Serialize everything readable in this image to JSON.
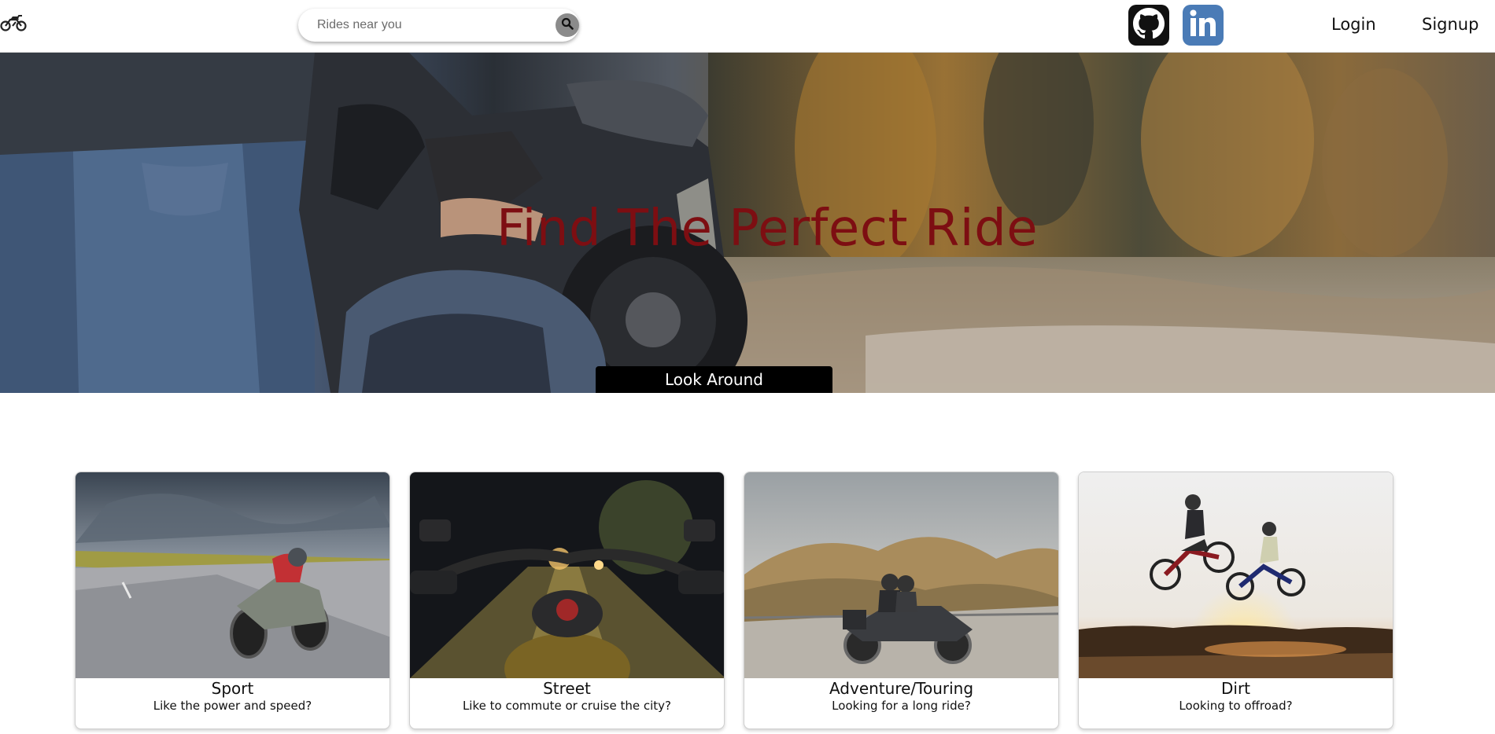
{
  "header": {
    "logo_icon": "motorcycle-icon",
    "search": {
      "placeholder": "Rides near you",
      "value": "",
      "button_icon": "search-icon"
    },
    "social": [
      {
        "name": "github",
        "icon": "github-icon",
        "color": "#111111"
      },
      {
        "name": "linkedin",
        "icon": "linkedin-icon",
        "color": "#4a7bb6"
      }
    ],
    "nav": {
      "login_label": "Login",
      "signup_label": "Signup"
    }
  },
  "hero": {
    "title": "Find The Perfect Ride",
    "title_color": "#7d0e12",
    "button_label": "Look Around"
  },
  "cards": [
    {
      "title": "Sport",
      "subtitle": "Like the power and speed?"
    },
    {
      "title": "Street",
      "subtitle": "Like to commute or cruise the city?"
    },
    {
      "title": "Adventure/Touring",
      "subtitle": "Looking for a long ride?"
    },
    {
      "title": "Dirt",
      "subtitle": "Looking to offroad?"
    }
  ]
}
